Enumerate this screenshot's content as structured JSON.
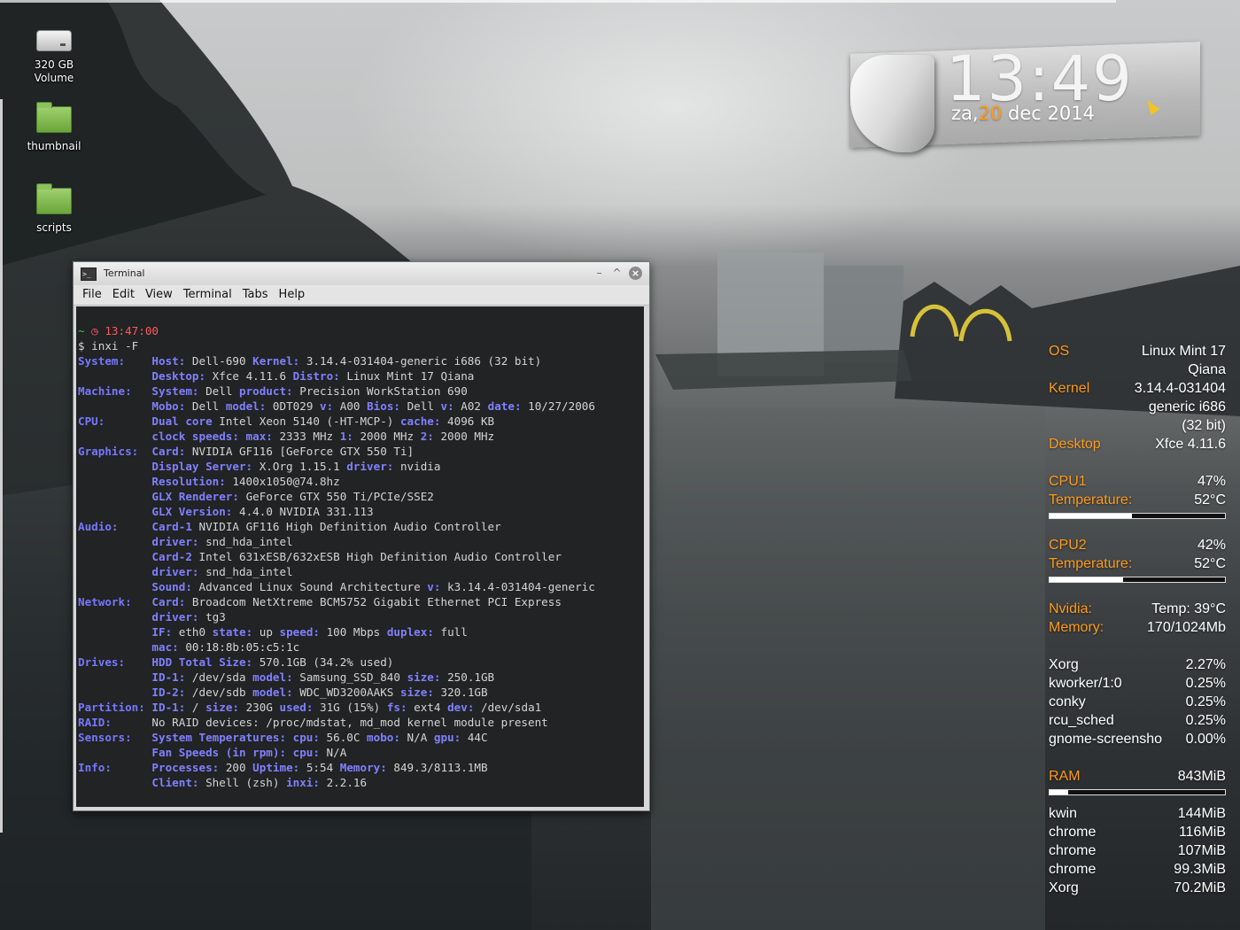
{
  "desktop": {
    "icons": [
      {
        "label": "320 GB Volume",
        "icon": "drive-icon"
      },
      {
        "label": "thumbnail",
        "icon": "folder-icon"
      },
      {
        "label": "scripts",
        "icon": "folder-icon"
      }
    ]
  },
  "clock": {
    "time": "13:49",
    "day_abbr": "za,",
    "day_num": "20",
    "month_year": "dec 2014",
    "accent": "#ff9b1a"
  },
  "terminal": {
    "title": "Terminal",
    "menu": [
      "File",
      "Edit",
      "View",
      "Terminal",
      "Tabs",
      "Help"
    ],
    "prompt_time": "13:47:00",
    "command": "$ inxi -F",
    "lines": [
      [
        {
          "c": "cat",
          "t": "System:    "
        },
        {
          "c": "k",
          "t": "Host:"
        },
        {
          "t": " Dell-690 "
        },
        {
          "c": "k",
          "t": "Kernel:"
        },
        {
          "t": " 3.14.4-031404-generic i686 (32 bit)"
        }
      ],
      [
        {
          "t": "           "
        },
        {
          "c": "k",
          "t": "Desktop:"
        },
        {
          "t": " Xfce 4.11.6 "
        },
        {
          "c": "k",
          "t": "Distro:"
        },
        {
          "t": " Linux Mint 17 Qiana"
        }
      ],
      [
        {
          "c": "cat",
          "t": "Machine:   "
        },
        {
          "c": "k",
          "t": "System:"
        },
        {
          "t": " Dell "
        },
        {
          "c": "k",
          "t": "product:"
        },
        {
          "t": " Precision WorkStation 690"
        }
      ],
      [
        {
          "t": "           "
        },
        {
          "c": "k",
          "t": "Mobo:"
        },
        {
          "t": " Dell "
        },
        {
          "c": "k",
          "t": "model:"
        },
        {
          "t": " 0DT029 "
        },
        {
          "c": "k",
          "t": "v:"
        },
        {
          "t": " A00 "
        },
        {
          "c": "k",
          "t": "Bios:"
        },
        {
          "t": " Dell "
        },
        {
          "c": "k",
          "t": "v:"
        },
        {
          "t": " A02 "
        },
        {
          "c": "k",
          "t": "date:"
        },
        {
          "t": " 10/27/2006"
        }
      ],
      [
        {
          "c": "cat",
          "t": "CPU:       "
        },
        {
          "c": "k",
          "t": "Dual core"
        },
        {
          "t": " Intel Xeon 5140 (-HT-MCP-) "
        },
        {
          "c": "k",
          "t": "cache:"
        },
        {
          "t": " 4096 KB"
        }
      ],
      [
        {
          "t": "           "
        },
        {
          "c": "k",
          "t": "clock speeds: max:"
        },
        {
          "t": " 2333 MHz "
        },
        {
          "c": "k",
          "t": "1:"
        },
        {
          "t": " 2000 MHz "
        },
        {
          "c": "k",
          "t": "2:"
        },
        {
          "t": " 2000 MHz"
        }
      ],
      [
        {
          "c": "cat",
          "t": "Graphics:  "
        },
        {
          "c": "k",
          "t": "Card:"
        },
        {
          "t": " NVIDIA GF116 [GeForce GTX 550 Ti]"
        }
      ],
      [
        {
          "t": "           "
        },
        {
          "c": "k",
          "t": "Display Server:"
        },
        {
          "t": " X.Org 1.15.1 "
        },
        {
          "c": "k",
          "t": "driver:"
        },
        {
          "t": " nvidia"
        }
      ],
      [
        {
          "t": "           "
        },
        {
          "c": "k",
          "t": "Resolution:"
        },
        {
          "t": " 1400x1050@74.8hz"
        }
      ],
      [
        {
          "t": "           "
        },
        {
          "c": "k",
          "t": "GLX Renderer:"
        },
        {
          "t": " GeForce GTX 550 Ti/PCIe/SSE2"
        }
      ],
      [
        {
          "t": "           "
        },
        {
          "c": "k",
          "t": "GLX Version:"
        },
        {
          "t": " 4.4.0 NVIDIA 331.113"
        }
      ],
      [
        {
          "c": "cat",
          "t": "Audio:     "
        },
        {
          "c": "k",
          "t": "Card-1"
        },
        {
          "t": " NVIDIA GF116 High Definition Audio Controller"
        }
      ],
      [
        {
          "t": "           "
        },
        {
          "c": "k",
          "t": "driver:"
        },
        {
          "t": " snd_hda_intel"
        }
      ],
      [
        {
          "t": "           "
        },
        {
          "c": "k",
          "t": "Card-2"
        },
        {
          "t": " Intel 631xESB/632xESB High Definition Audio Controller"
        }
      ],
      [
        {
          "t": "           "
        },
        {
          "c": "k",
          "t": "driver:"
        },
        {
          "t": " snd_hda_intel"
        }
      ],
      [
        {
          "t": "           "
        },
        {
          "c": "k",
          "t": "Sound:"
        },
        {
          "t": " Advanced Linux Sound Architecture "
        },
        {
          "c": "k",
          "t": "v:"
        },
        {
          "t": " k3.14.4-031404-generic"
        }
      ],
      [
        {
          "c": "cat",
          "t": "Network:   "
        },
        {
          "c": "k",
          "t": "Card:"
        },
        {
          "t": " Broadcom NetXtreme BCM5752 Gigabit Ethernet PCI Express"
        }
      ],
      [
        {
          "t": "           "
        },
        {
          "c": "k",
          "t": "driver:"
        },
        {
          "t": " tg3"
        }
      ],
      [
        {
          "t": "           "
        },
        {
          "c": "k",
          "t": "IF:"
        },
        {
          "t": " eth0 "
        },
        {
          "c": "k",
          "t": "state:"
        },
        {
          "t": " up "
        },
        {
          "c": "k",
          "t": "speed:"
        },
        {
          "t": " 100 Mbps "
        },
        {
          "c": "k",
          "t": "duplex:"
        },
        {
          "t": " full"
        }
      ],
      [
        {
          "t": "           "
        },
        {
          "c": "k",
          "t": "mac:"
        },
        {
          "t": " 00:18:8b:05:c5:1c"
        }
      ],
      [
        {
          "c": "cat",
          "t": "Drives:    "
        },
        {
          "c": "k",
          "t": "HDD Total Size:"
        },
        {
          "t": " 570.1GB (34.2% used)"
        }
      ],
      [
        {
          "t": "           "
        },
        {
          "c": "k",
          "t": "ID-1:"
        },
        {
          "t": " /dev/sda "
        },
        {
          "c": "k",
          "t": "model:"
        },
        {
          "t": " Samsung_SSD_840 "
        },
        {
          "c": "k",
          "t": "size:"
        },
        {
          "t": " 250.1GB"
        }
      ],
      [
        {
          "t": "           "
        },
        {
          "c": "k",
          "t": "ID-2:"
        },
        {
          "t": " /dev/sdb "
        },
        {
          "c": "k",
          "t": "model:"
        },
        {
          "t": " WDC_WD3200AAKS "
        },
        {
          "c": "k",
          "t": "size:"
        },
        {
          "t": " 320.1GB"
        }
      ],
      [
        {
          "c": "cat",
          "t": "Partition: "
        },
        {
          "c": "k",
          "t": "ID-1:"
        },
        {
          "t": " / "
        },
        {
          "c": "k",
          "t": "size:"
        },
        {
          "t": " 230G "
        },
        {
          "c": "k",
          "t": "used:"
        },
        {
          "t": " 31G (15%) "
        },
        {
          "c": "k",
          "t": "fs:"
        },
        {
          "t": " ext4 "
        },
        {
          "c": "k",
          "t": "dev:"
        },
        {
          "t": " /dev/sda1"
        }
      ],
      [
        {
          "c": "cat",
          "t": "RAID:      "
        },
        {
          "t": "No RAID devices: /proc/mdstat, md_mod kernel module present"
        }
      ],
      [
        {
          "c": "cat",
          "t": "Sensors:   "
        },
        {
          "c": "k",
          "t": "System Temperatures: cpu:"
        },
        {
          "t": " 56.0C "
        },
        {
          "c": "k",
          "t": "mobo:"
        },
        {
          "t": " N/A "
        },
        {
          "c": "k",
          "t": "gpu:"
        },
        {
          "t": " 44C"
        }
      ],
      [
        {
          "t": "           "
        },
        {
          "c": "k",
          "t": "Fan Speeds (in rpm): cpu:"
        },
        {
          "t": " N/A"
        }
      ],
      [
        {
          "c": "cat",
          "t": "Info:      "
        },
        {
          "c": "k",
          "t": "Processes:"
        },
        {
          "t": " 200 "
        },
        {
          "c": "k",
          "t": "Uptime:"
        },
        {
          "t": " 5:54 "
        },
        {
          "c": "k",
          "t": "Memory:"
        },
        {
          "t": " 849.3/8113.1MB"
        }
      ],
      [
        {
          "t": "           "
        },
        {
          "c": "k",
          "t": "Client:"
        },
        {
          "t": " Shell (zsh) "
        },
        {
          "c": "k",
          "t": "inxi:"
        },
        {
          "t": " 2.2.16"
        }
      ]
    ]
  },
  "conky": {
    "os_label": "OS",
    "os_value_1": "Linux Mint 17",
    "os_value_2": "Qiana",
    "kernel_label": "Kernel",
    "kernel_value_1": "3.14.4-031404",
    "kernel_value_2": "generic i686",
    "kernel_value_3": "(32 bit)",
    "desktop_label": "Desktop",
    "desktop_value": "Xfce 4.11.6",
    "cpu1_label": "CPU1",
    "cpu1_value": "47%",
    "cpu1_usage_fraction": 0.47,
    "cpu1_temp_label": "Temperature:",
    "cpu1_temp": "52°C",
    "cpu2_label": "CPU2",
    "cpu2_value": "42%",
    "cpu2_usage_fraction": 0.42,
    "cpu2_temp_label": "Temperature:",
    "cpu2_temp": "52°C",
    "nvidia_label": "Nvidia:",
    "nvidia_temp": "Temp: 39°C",
    "memory_label": "Memory:",
    "memory_value": "170/1024Mb",
    "cpu_procs": [
      {
        "name": "Xorg",
        "value": "2.27%"
      },
      {
        "name": "kworker/1:0",
        "value": "0.25%"
      },
      {
        "name": "conky",
        "value": "0.25%"
      },
      {
        "name": "rcu_sched",
        "value": "0.25%"
      },
      {
        "name": "gnome-screensho",
        "value": "0.00%"
      }
    ],
    "ram_label": "RAM",
    "ram_value": "843MiB",
    "ram_usage_fraction": 0.104,
    "mem_procs": [
      {
        "name": "kwin",
        "value": "144MiB"
      },
      {
        "name": "chrome",
        "value": "116MiB"
      },
      {
        "name": "chrome",
        "value": "107MiB"
      },
      {
        "name": "chrome",
        "value": "99.3MiB"
      },
      {
        "name": "Xorg",
        "value": "70.2MiB"
      }
    ],
    "accent": "#ff9b1a"
  }
}
